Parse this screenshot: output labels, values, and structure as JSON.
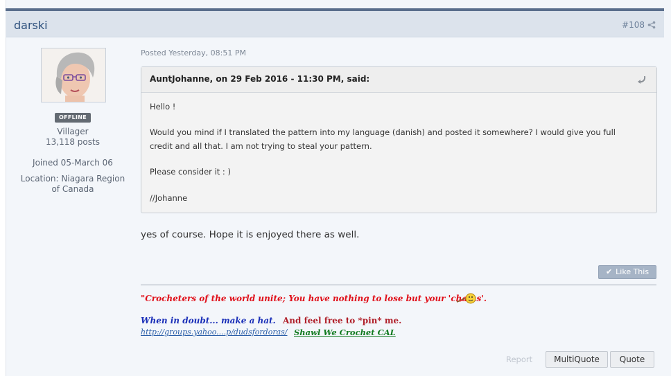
{
  "post": {
    "author": "darski",
    "number": "#108",
    "posted": "Posted Yesterday, 08:51 PM"
  },
  "author_info": {
    "status": "OFFLINE",
    "rank": "Villager",
    "posts": "13,118 posts",
    "joined": "Joined 05-March 06",
    "location_line1": "Location: Niagara Region",
    "location_line2": "of Canada"
  },
  "quote": {
    "citation": "AuntJohanne, on 29 Feb 2016 - 11:30 PM, said:",
    "line1": "Hello !",
    "line2a": "Would you mind if I translated the pattern into my language (danish) and posted it somewhere? I would give you full",
    "line2b": "credit and all that. I am not trying to steal your pattern.",
    "line3": "Please consider it : )",
    "line4": "//Johanne"
  },
  "reply": "yes of course.  Hope it is enjoyed there as well.",
  "like_label": "Like This",
  "signature": {
    "quote": "\"Crocheters of the world unite; You have nothing to lose but your 'chains'.",
    "hat": "When in doubt... make a hat.",
    "pin": "And feel free to *pin* me.",
    "link": "http://groups.yahoo....p/dudsfordoras/",
    "cal": "Shawl We Crochet CAL"
  },
  "actions": {
    "report": "Report",
    "multiquote": "MultiQuote",
    "quote": "Quote"
  },
  "colors": {
    "header_bg": "#dce3ec",
    "accent": "#5a6e8c",
    "sig_red": "#e0101a",
    "sig_blue": "#1a2fb8",
    "sig_green": "#117a1f"
  },
  "icons": [
    "share-icon",
    "quote-jump-icon",
    "check-icon",
    "avatar-image",
    "crochet-smiley-icon"
  ]
}
